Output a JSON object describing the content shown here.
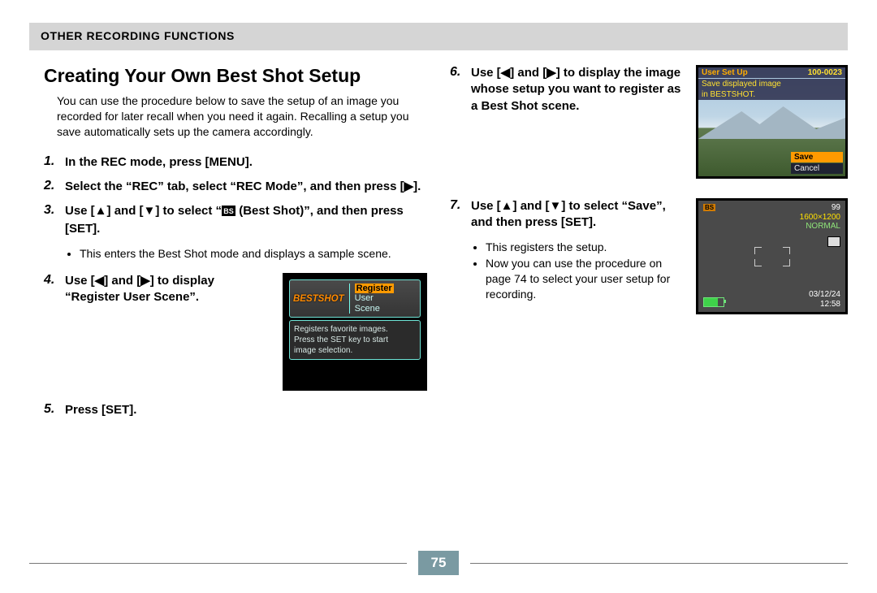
{
  "header": {
    "title": "OTHER RECORDING FUNCTIONS"
  },
  "heading": "Creating Your Own Best Shot Setup",
  "intro": "You can use the procedure below to save the setup of an image you recorded for later recall when you need it again. Recalling a setup you save automatically sets up the camera accordingly.",
  "steps": {
    "s1": {
      "num": "1.",
      "text": "In the REC mode, press [MENU]."
    },
    "s2": {
      "num": "2.",
      "text": "Select the “REC” tab, select “REC Mode”, and then press [▶]."
    },
    "s3": {
      "num": "3.",
      "pre": "Use [▲] and [▼] to select “",
      "icon_label": "BS",
      "post": " (Best Shot)”, and then press [SET].",
      "b1": "This enters the Best Shot mode and displays a sample scene."
    },
    "s4": {
      "num": "4.",
      "text": "Use [◀] and [▶] to display “Register User Scene”."
    },
    "s5": {
      "num": "5.",
      "text": "Press [SET]."
    },
    "s6": {
      "num": "6.",
      "text": "Use [◀] and [▶] to display the image whose setup you want to register as a Best Shot scene."
    },
    "s7": {
      "num": "7.",
      "text": "Use [▲] and [▼] to select “Save”, and then press [SET].",
      "b1": "This registers the setup.",
      "b2": "Now you can use the procedure on page 74 to select your user setup for recording."
    }
  },
  "screen1": {
    "logo": "BESTSHOT",
    "menu": {
      "hl": "Register",
      "l2": "User",
      "l3": "Scene"
    },
    "caption_l1": "Registers favorite images.",
    "caption_l2": "Press the SET key to start",
    "caption_l3": "image selection."
  },
  "screen2": {
    "title_left": "User Set Up",
    "title_right": "100-0023",
    "line2": "Save displayed image",
    "line3": "in BESTSHOT.",
    "save": "Save",
    "cancel": "Cancel"
  },
  "screen3": {
    "bs": "BS",
    "shots": "99",
    "res": "1600×1200",
    "quality": "NORMAL",
    "date": "03/12/24",
    "time": "12:58"
  },
  "page_number": "75"
}
